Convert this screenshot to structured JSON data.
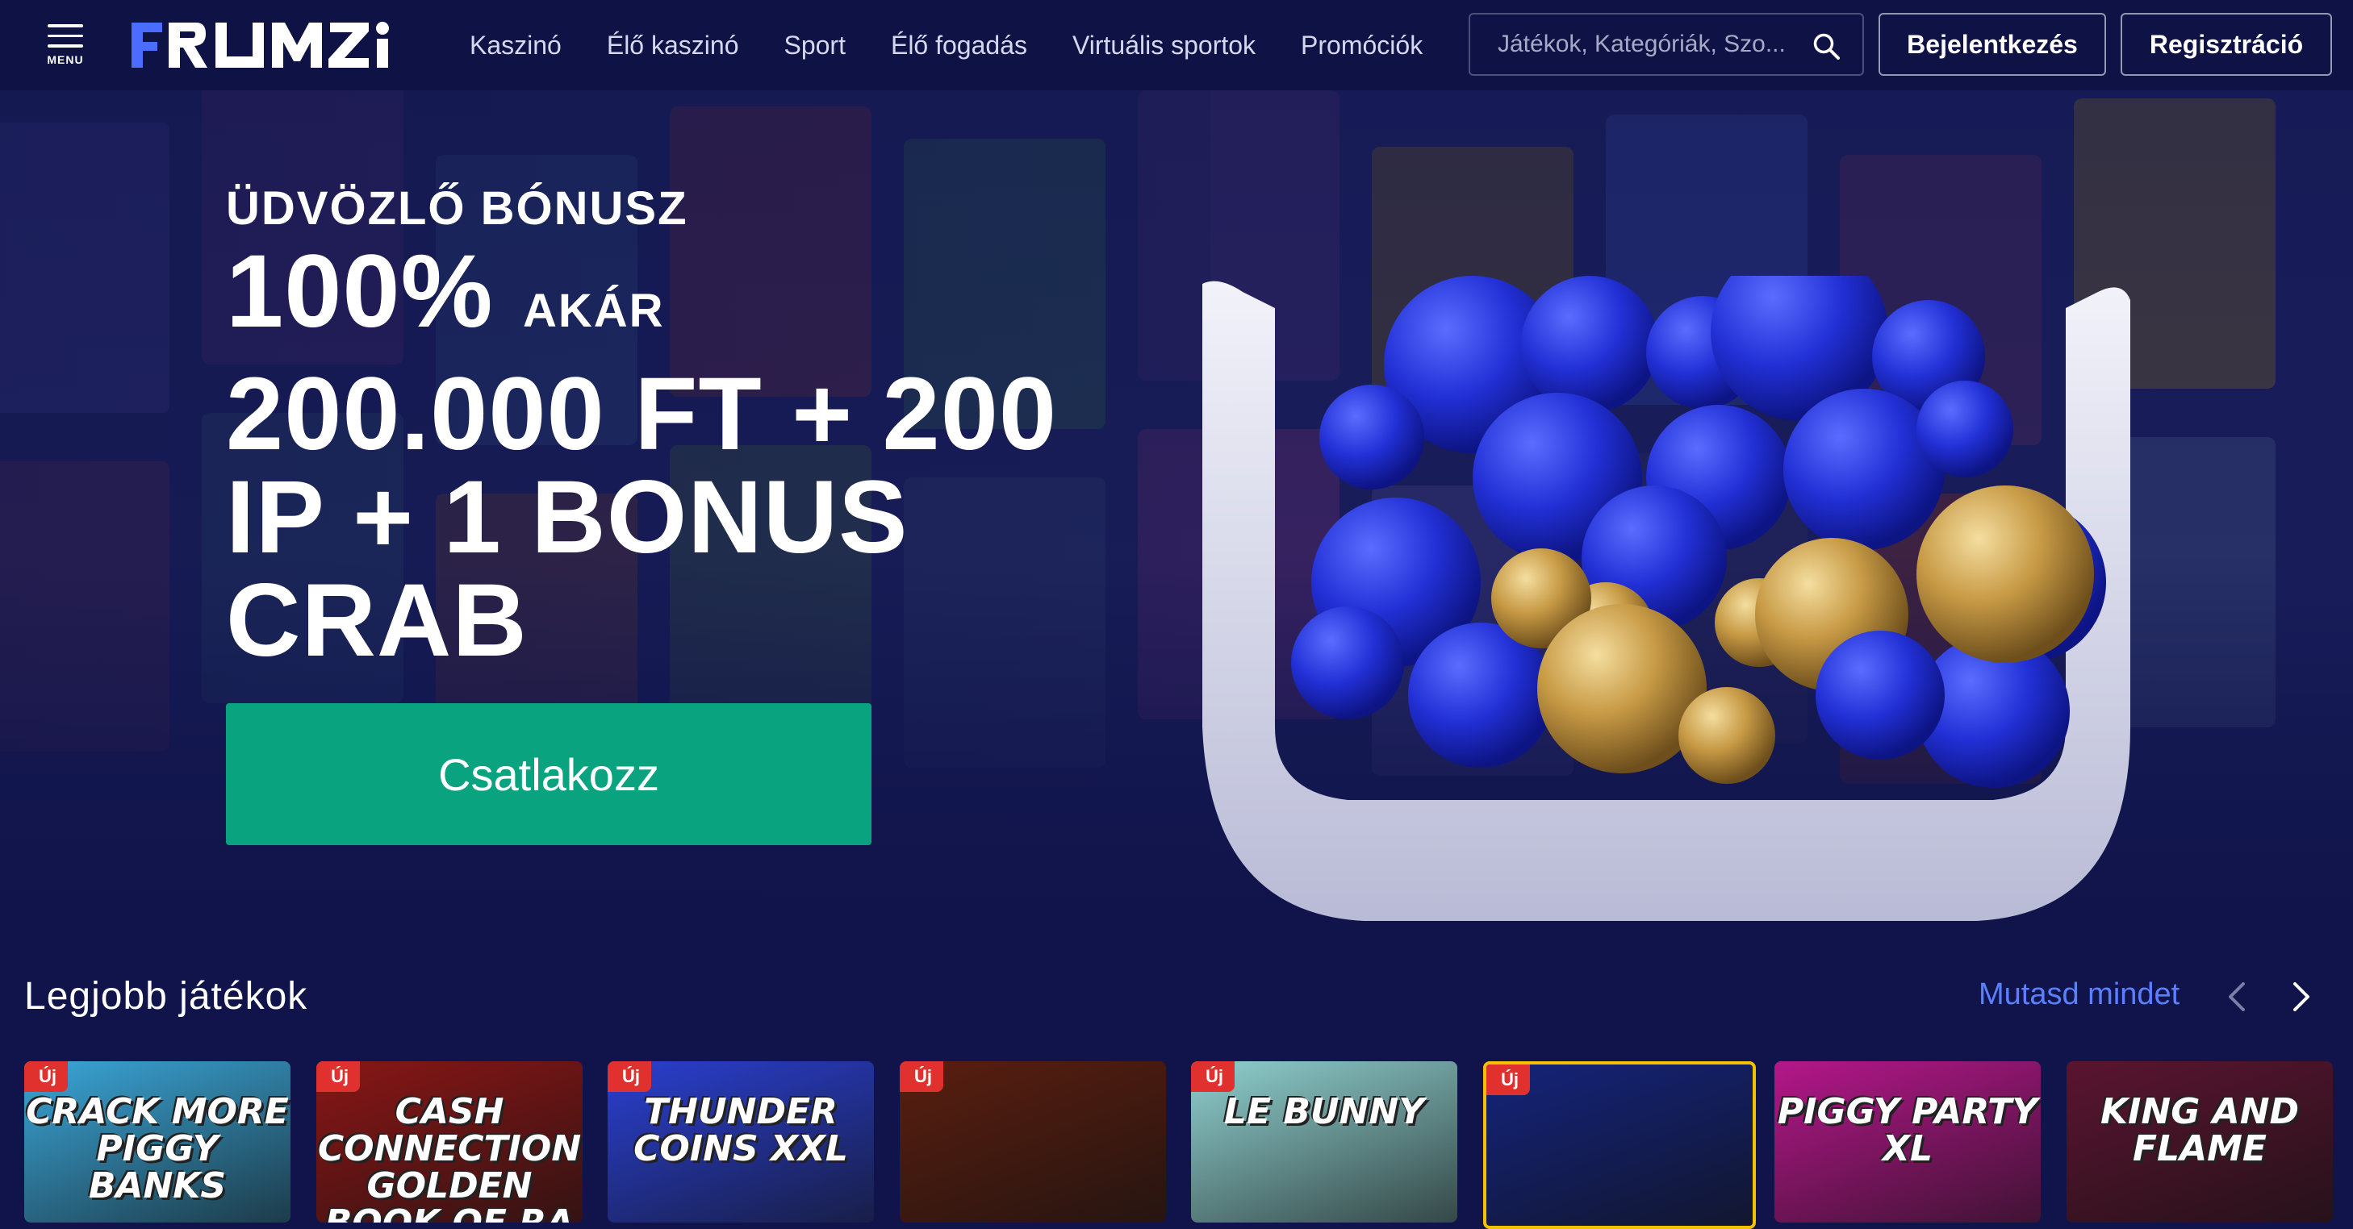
{
  "header": {
    "menu_label": "MENU",
    "logo_text": "FRUMZI",
    "nav": [
      "Kaszinó",
      "Élő kaszinó",
      "Sport",
      "Élő fogadás",
      "Virtuális sportok",
      "Promóciók"
    ],
    "search_placeholder": "Játékok, Kategóriák, Szo...",
    "login_label": "Bejelentkezés",
    "register_label": "Regisztráció"
  },
  "hero": {
    "kicker": "ÜDVÖZLŐ BÓNUSZ",
    "line1_big": "100%",
    "line1_small": "AKÁR",
    "line2": "200.000 FT + 200",
    "line3": "IP + 1 BONUS",
    "line4": "CRAB",
    "cta_label": "Csatlakozz"
  },
  "games_section": {
    "title": "Legjobb játékok",
    "show_all": "Mutasd mindet",
    "new_badge": "Új",
    "games": [
      {
        "title": "CRACK MORE PIGGY BANKS",
        "is_new": true,
        "bg": "#3aa6d8"
      },
      {
        "title": "CASH CONNECTION GOLDEN BOOK OF RA",
        "is_new": true,
        "bg": "#8a1616"
      },
      {
        "title": "THUNDER COINS XXL",
        "is_new": true,
        "bg": "#2a3fd0"
      },
      {
        "title": "",
        "is_new": true,
        "bg": "#5a1e10"
      },
      {
        "title": "LE BUNNY",
        "is_new": true,
        "bg": "#8fd0cf"
      },
      {
        "title": "",
        "is_new": true,
        "bg": "#14237a"
      },
      {
        "title": "PIGGY PARTY XL",
        "is_new": false,
        "bg": "#b4178a"
      },
      {
        "title": "KING AND FLAME",
        "is_new": false,
        "bg": "#5a1430"
      }
    ]
  },
  "colors": {
    "page_bg": "#10144a",
    "header_bg": "#0f1245",
    "accent_blue": "#4a6cff",
    "cta_green": "#0aa37f",
    "badge_red": "#e0312f",
    "link_blue": "#5a80ff"
  }
}
